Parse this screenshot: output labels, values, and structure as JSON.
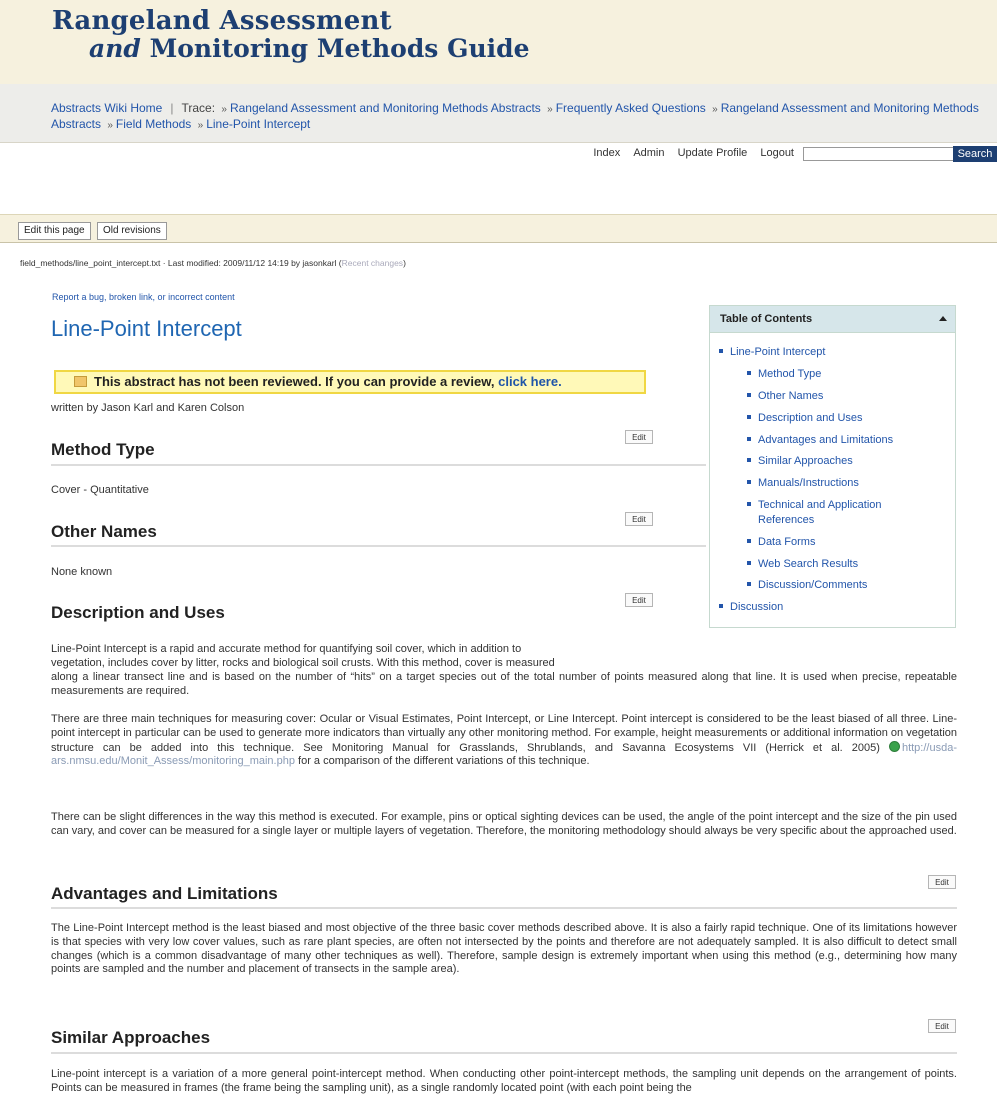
{
  "header": {
    "title_line1": "Rangeland Assessment",
    "title_and": "and",
    "title_line2": "Monitoring Methods Guide"
  },
  "breadcrumb": {
    "home": "Abstracts Wiki Home",
    "trace_label": "Trace:",
    "items": [
      "Rangeland Assessment and Monitoring Methods Abstracts",
      "Frequently Asked Questions",
      "Rangeland Assessment and Monitoring Methods",
      "Abstracts",
      "Field Methods",
      "Line-Point Intercept"
    ]
  },
  "userbar": {
    "links": [
      "Index",
      "Admin",
      "Update Profile",
      "Logout"
    ],
    "search_value": "",
    "search_button": "Search"
  },
  "tabs": [
    "Edit this page",
    "Old revisions"
  ],
  "meta": {
    "text": "field_methods/line_point_intercept.txt · Last modified: 2009/11/12 14:19 by jasonkarl (",
    "recent": "Recent changes",
    "close": ")"
  },
  "report_link": "Report a bug, broken link, or incorrect content",
  "page_title": "Line-Point Intercept",
  "notice": {
    "text": "This abstract has not been reviewed.  If you can provide a review,",
    "link": "click here."
  },
  "author": "written by Jason Karl and Karen Colson",
  "edit_label": "Edit",
  "sections": {
    "method_type": {
      "heading": "Method Type",
      "body": "Cover - Quantitative"
    },
    "other_names": {
      "heading": "Other Names",
      "body": "None known"
    },
    "description": {
      "heading": "Description and Uses",
      "p1a": "Line-Point Intercept is a rapid and accurate method for quantifying soil cover, which in addition to",
      "p1b": "vegetation, includes cover by litter, rocks and biological soil crusts. With this method, cover is measured",
      "p1c": "along a linear transect line and is based on the number of “hits” on a target species out of the total number of points measured along that line. It is used when precise, repeatable measurements are required.",
      "p2": "There are three main techniques for measuring cover: Ocular or Visual Estimates, Point Intercept, or Line Intercept. Point intercept is considered to be the least biased of all three. Line-point intercept in particular can be used to generate more indicators than virtually any other monitoring method. For example, height measurements or additional information on vegetation structure can be added into this technique. See Monitoring Manual for Grasslands, Shrublands, and Savanna Ecosystems VII (Herrick et al. 2005)",
      "p2_url": "http://usda-ars.nmsu.edu/Monit_Assess/monitoring_main.php",
      "p2_end": "for a comparison of the different variations of this technique.",
      "p3": "There can be slight differences in the way this method is executed. For example, pins or optical sighting devices can be used, the angle of the point intercept and the size of the pin used can vary, and cover can be measured for a single layer or multiple layers of vegetation. Therefore, the monitoring methodology should always be very specific about the approached used."
    },
    "advantages": {
      "heading": "Advantages and Limitations",
      "body": "The Line-Point Intercept method is the least biased and most objective of the three basic cover methods described above. It is also a fairly rapid technique. One of its limitations however is that species with very low cover values, such as rare plant species, are often not intersected by the points and therefore are not adequately sampled. It is also difficult to detect small changes (which is a common disadvantage of many other techniques as well). Therefore, sample design is extremely important when using this method (e.g., determining how many points are sampled and the number and placement of transects in the sample area)."
    },
    "similar": {
      "heading": "Similar Approaches",
      "body": "Line-point intercept is a variation of a more general point-intercept method. When conducting other point-intercept methods, the sampling unit depends on the arrangement of points. Points can be measured in frames (the frame being the sampling unit), as a single randomly located point (with each point being the"
    }
  },
  "toc": {
    "title": "Table of Contents",
    "items": [
      "Line-Point Intercept",
      "Method Type",
      "Other Names",
      "Description and Uses",
      "Advantages and Limitations",
      "Similar Approaches",
      "Manuals/Instructions",
      "Technical and Application",
      "References",
      "Data Forms",
      "Web Search Results",
      "Discussion/Comments",
      "Discussion"
    ]
  }
}
